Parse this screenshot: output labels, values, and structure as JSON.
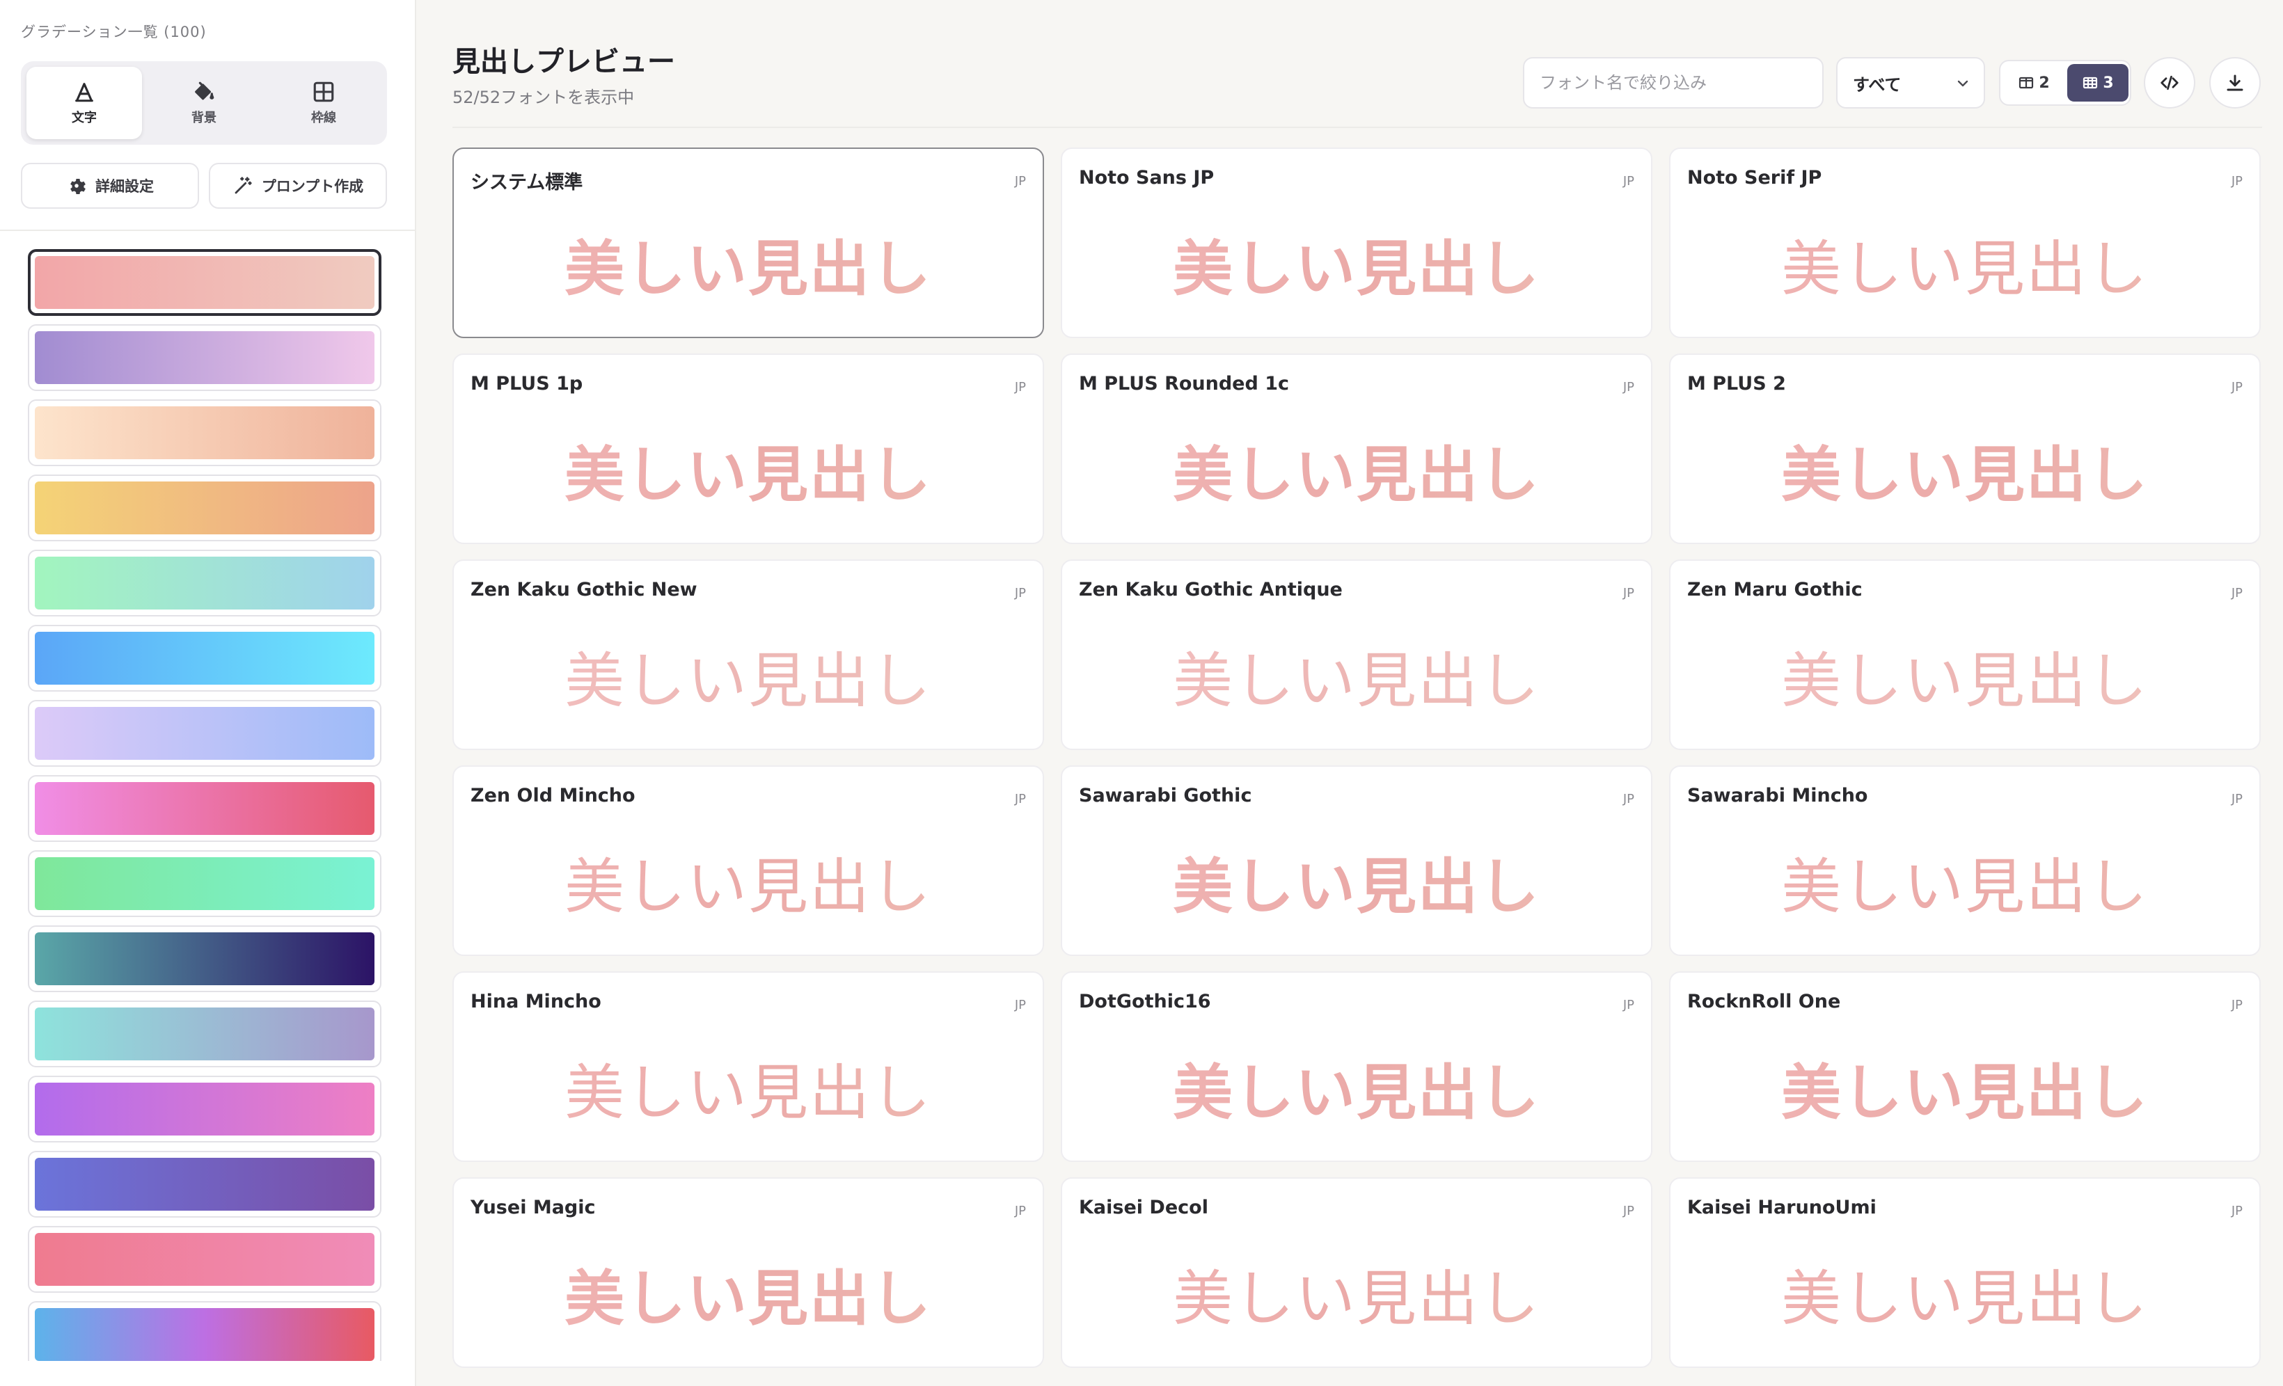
{
  "sidebar": {
    "title": "グラデーション一覧 (100)",
    "modes": [
      {
        "label": "文字",
        "icon": "text-a-icon",
        "active": true
      },
      {
        "label": "背景",
        "icon": "paint-bucket-icon",
        "active": false
      },
      {
        "label": "枠線",
        "icon": "border-grid-icon",
        "active": false
      }
    ],
    "actions": {
      "settings_label": "詳細設定",
      "prompt_label": "プロンプト作成"
    },
    "gradients": [
      {
        "from": "#f2a6a8",
        "to": "#f0cbc0",
        "selected": true
      },
      {
        "from": "#a18cd1",
        "to": "#f0c8ea",
        "selected": false
      },
      {
        "from": "#fde4cc",
        "to": "#efb29a",
        "selected": false
      },
      {
        "from": "#f4d376",
        "to": "#eda38b",
        "selected": false
      },
      {
        "from": "#a2f5be",
        "to": "#a0d2ec",
        "selected": false
      },
      {
        "from": "#5ba6f7",
        "to": "#6deafd",
        "selected": false
      },
      {
        "from": "#dccaf8",
        "to": "#9dbbf8",
        "selected": false
      },
      {
        "from": "#f08ee6",
        "to": "#e65a6e",
        "selected": false
      },
      {
        "from": "#7fe79a",
        "to": "#7af2d4",
        "selected": false
      },
      {
        "from": "#5aa7a8",
        "to": "#2c1366",
        "selected": false
      },
      {
        "from": "#8ee3dc",
        "to": "#a797cc",
        "selected": false
      },
      {
        "from": "#b26cec",
        "to": "#ee7fc4",
        "selected": false
      },
      {
        "from": "#6b74da",
        "to": "#7a4ea6",
        "selected": false
      },
      {
        "from": "#ef7b8f",
        "to": "#f08cb8",
        "selected": false
      },
      {
        "from": "#5db3ea",
        "mid": "#bd6fe3",
        "to": "#e85a62",
        "selected": false
      }
    ]
  },
  "header": {
    "title": "見出しプレビュー",
    "subtitle": "52/52フォントを表示中",
    "search_placeholder": "フォント名で絞り込み",
    "filter_value": "すべて",
    "col2_label": "2",
    "col3_label": "3",
    "active_columns": 3
  },
  "preview_text": "美しい見出し",
  "text_gradient": {
    "from": "#f2b7b7",
    "to": "#efbeb4"
  },
  "fonts": [
    {
      "name": "システム標準",
      "tag": "JP",
      "style": "w-bold",
      "selected": true
    },
    {
      "name": "Noto Sans JP",
      "tag": "JP",
      "style": "w-bold"
    },
    {
      "name": "Noto Serif JP",
      "tag": "JP",
      "style": "serif"
    },
    {
      "name": "M PLUS 1p",
      "tag": "JP",
      "style": "w-bold"
    },
    {
      "name": "M PLUS Rounded 1c",
      "tag": "JP",
      "style": "w-bold"
    },
    {
      "name": "M PLUS 2",
      "tag": "JP",
      "style": "w-bold"
    },
    {
      "name": "Zen Kaku Gothic New",
      "tag": "JP",
      "style": "w-light"
    },
    {
      "name": "Zen Kaku Gothic Antique",
      "tag": "JP",
      "style": "w-light"
    },
    {
      "name": "Zen Maru Gothic",
      "tag": "JP",
      "style": "w-light"
    },
    {
      "name": "Zen Old Mincho",
      "tag": "JP",
      "style": "serif"
    },
    {
      "name": "Sawarabi Gothic",
      "tag": "JP",
      "style": "w-bold"
    },
    {
      "name": "Sawarabi Mincho",
      "tag": "JP",
      "style": "serif"
    },
    {
      "name": "Hina Mincho",
      "tag": "JP",
      "style": "serif"
    },
    {
      "name": "DotGothic16",
      "tag": "JP",
      "style": "mono"
    },
    {
      "name": "RocknRoll One",
      "tag": "JP",
      "style": "w-bold"
    },
    {
      "name": "Yusei Magic",
      "tag": "JP",
      "style": "w-bold"
    },
    {
      "name": "Kaisei Decol",
      "tag": "JP",
      "style": "serif"
    },
    {
      "name": "Kaisei HarunoUmi",
      "tag": "JP",
      "style": "serif"
    }
  ]
}
